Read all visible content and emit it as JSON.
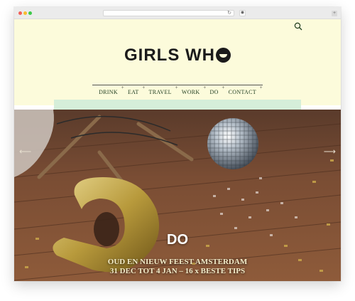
{
  "browser": {
    "reload_glyph": "↻",
    "ext_glyph": "◉",
    "newtab_glyph": "+"
  },
  "site": {
    "logo_text": "GIRLS WH",
    "logo_last_glyph": "O",
    "search_icon": "search-icon",
    "colors": {
      "header_bg": "#fcfbdb",
      "mint": "#d5eed9",
      "nav_text": "#1d3b1d"
    }
  },
  "nav": {
    "items": [
      {
        "label": "DRINK",
        "plus": "+"
      },
      {
        "label": "EAT",
        "plus": "+"
      },
      {
        "label": "TRAVEL",
        "plus": "+"
      },
      {
        "label": "WORK",
        "plus": "+"
      },
      {
        "label": "DO",
        "plus": "+"
      },
      {
        "label": "CONTACT",
        "plus": "+"
      }
    ]
  },
  "slider": {
    "prev_glyph": "⟵",
    "next_glyph": "⟶",
    "category": "DO",
    "title_line1": "OUD EN NIEUW FEEST AMSTERDAM",
    "title_line2": "31 DEC TOT 4 JAN – 16 x BESTE TIPS"
  }
}
